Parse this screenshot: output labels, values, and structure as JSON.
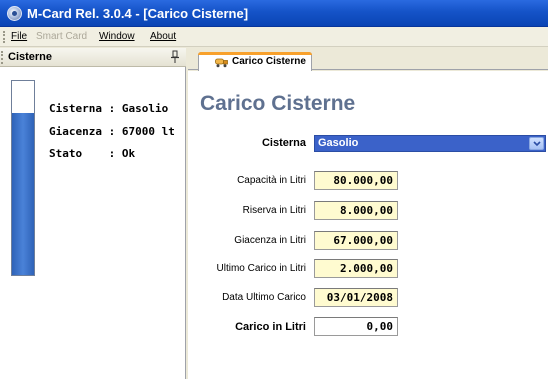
{
  "window": {
    "title": "M-Card Rel. 3.0.4 - [Carico Cisterne]"
  },
  "menu": [
    {
      "label": "File",
      "hotkey_index": 0,
      "enabled": true
    },
    {
      "label": "Smart Card",
      "hotkey_index": null,
      "enabled": false
    },
    {
      "label": "Window",
      "hotkey_index": 0,
      "enabled": true
    },
    {
      "label": "About",
      "hotkey_index": 0,
      "enabled": true
    }
  ],
  "dock": {
    "title": "Cisterne",
    "pin_icon": "pin-icon",
    "tank": {
      "level_fraction": 0.837,
      "fill_color": "#3b72c8",
      "lines": [
        {
          "key": "Cisterna",
          "sep": " : ",
          "value": "Gasolio"
        },
        {
          "key": "Giacenza",
          "sep": " : ",
          "value": "67000 lt"
        },
        {
          "key": "Stato",
          "sep": "    : ",
          "value": "Ok"
        }
      ]
    }
  },
  "tabs": [
    {
      "label": "Carico Cisterne",
      "icon": "tank-truck-icon",
      "active": true
    }
  ],
  "form": {
    "title": "Carico Cisterne",
    "cisterna": {
      "label": "Cisterna",
      "value": "Gasolio"
    },
    "fields": [
      {
        "label": "Capacità in Litri",
        "value": "80.000,00"
      },
      {
        "label": "Riserva in Litri",
        "value": "8.000,00"
      },
      {
        "label": "Giacenza in Litri",
        "value": "67.000,00"
      },
      {
        "label": "Ultimo Carico in Litri",
        "value": "2.000,00"
      },
      {
        "label": "Data Ultimo Carico",
        "value": "03/01/2008"
      }
    ],
    "carico": {
      "label": "Carico in Litri",
      "value": "0,00"
    }
  },
  "colors": {
    "titlebar": "#1553c8",
    "select_bg": "#3b62c9",
    "readonly_field_bg": "#fffbd0",
    "tab_accent": "#f8a12c",
    "page_title": "#5f7190"
  }
}
